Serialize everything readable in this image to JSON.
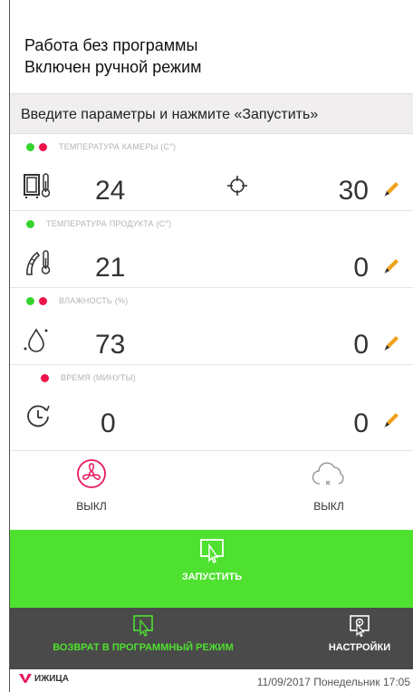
{
  "header": {
    "line1": "Работа без программы",
    "line2": "Включен ручной режим"
  },
  "instruction": "Введите параметры и нажмите «Запустить»",
  "params": [
    {
      "label": "ТЕМПЕРАТУРА КАМЕРЫ (С°)",
      "value": "24",
      "setpoint": "30",
      "icon": "chamber-thermometer-icon",
      "dots": [
        "#35d42d",
        "#f0134a"
      ]
    },
    {
      "label": "ТЕМПЕРАТУРА ПРОДУКТА (С°)",
      "value": "21",
      "setpoint": "0",
      "icon": "product-thermometer-icon",
      "dots": [
        "#35d42d"
      ]
    },
    {
      "label": "ВЛАЖНОСТЬ (%)",
      "value": "73",
      "setpoint": "0",
      "icon": "humidity-drop-icon",
      "dots": [
        "#35d42d",
        "#f0134a"
      ]
    },
    {
      "label": "ВРЕМЯ (МИНУТЫ)",
      "value": "0",
      "setpoint": "0",
      "icon": "timer-icon",
      "dots": [
        "#f0134a"
      ]
    }
  ],
  "toggles": {
    "fan": {
      "label": "ВЫКЛ",
      "icon": "fan-icon",
      "color": "#e8185a"
    },
    "smoke": {
      "label": "ВЫКЛ",
      "icon": "cloud-off-icon",
      "color": "#9a9a9a"
    }
  },
  "start_button": {
    "label": "ЗАПУСТИТЬ",
    "color": "#4ee12f"
  },
  "bottom": {
    "return_label": "ВОЗВРАТ В ПРОГРАММНЫЙ РЕЖИМ",
    "return_color": "#4ee12f",
    "settings_label": "НАСТРОЙКИ"
  },
  "footer": {
    "logo_text": "ИЖИЦА",
    "datetime": "11/09/2017  Понедельник 17:05"
  },
  "colors": {
    "edit_pencil": "#f0a21b",
    "dot_green": "#35d42d",
    "dot_red": "#f0134a"
  }
}
